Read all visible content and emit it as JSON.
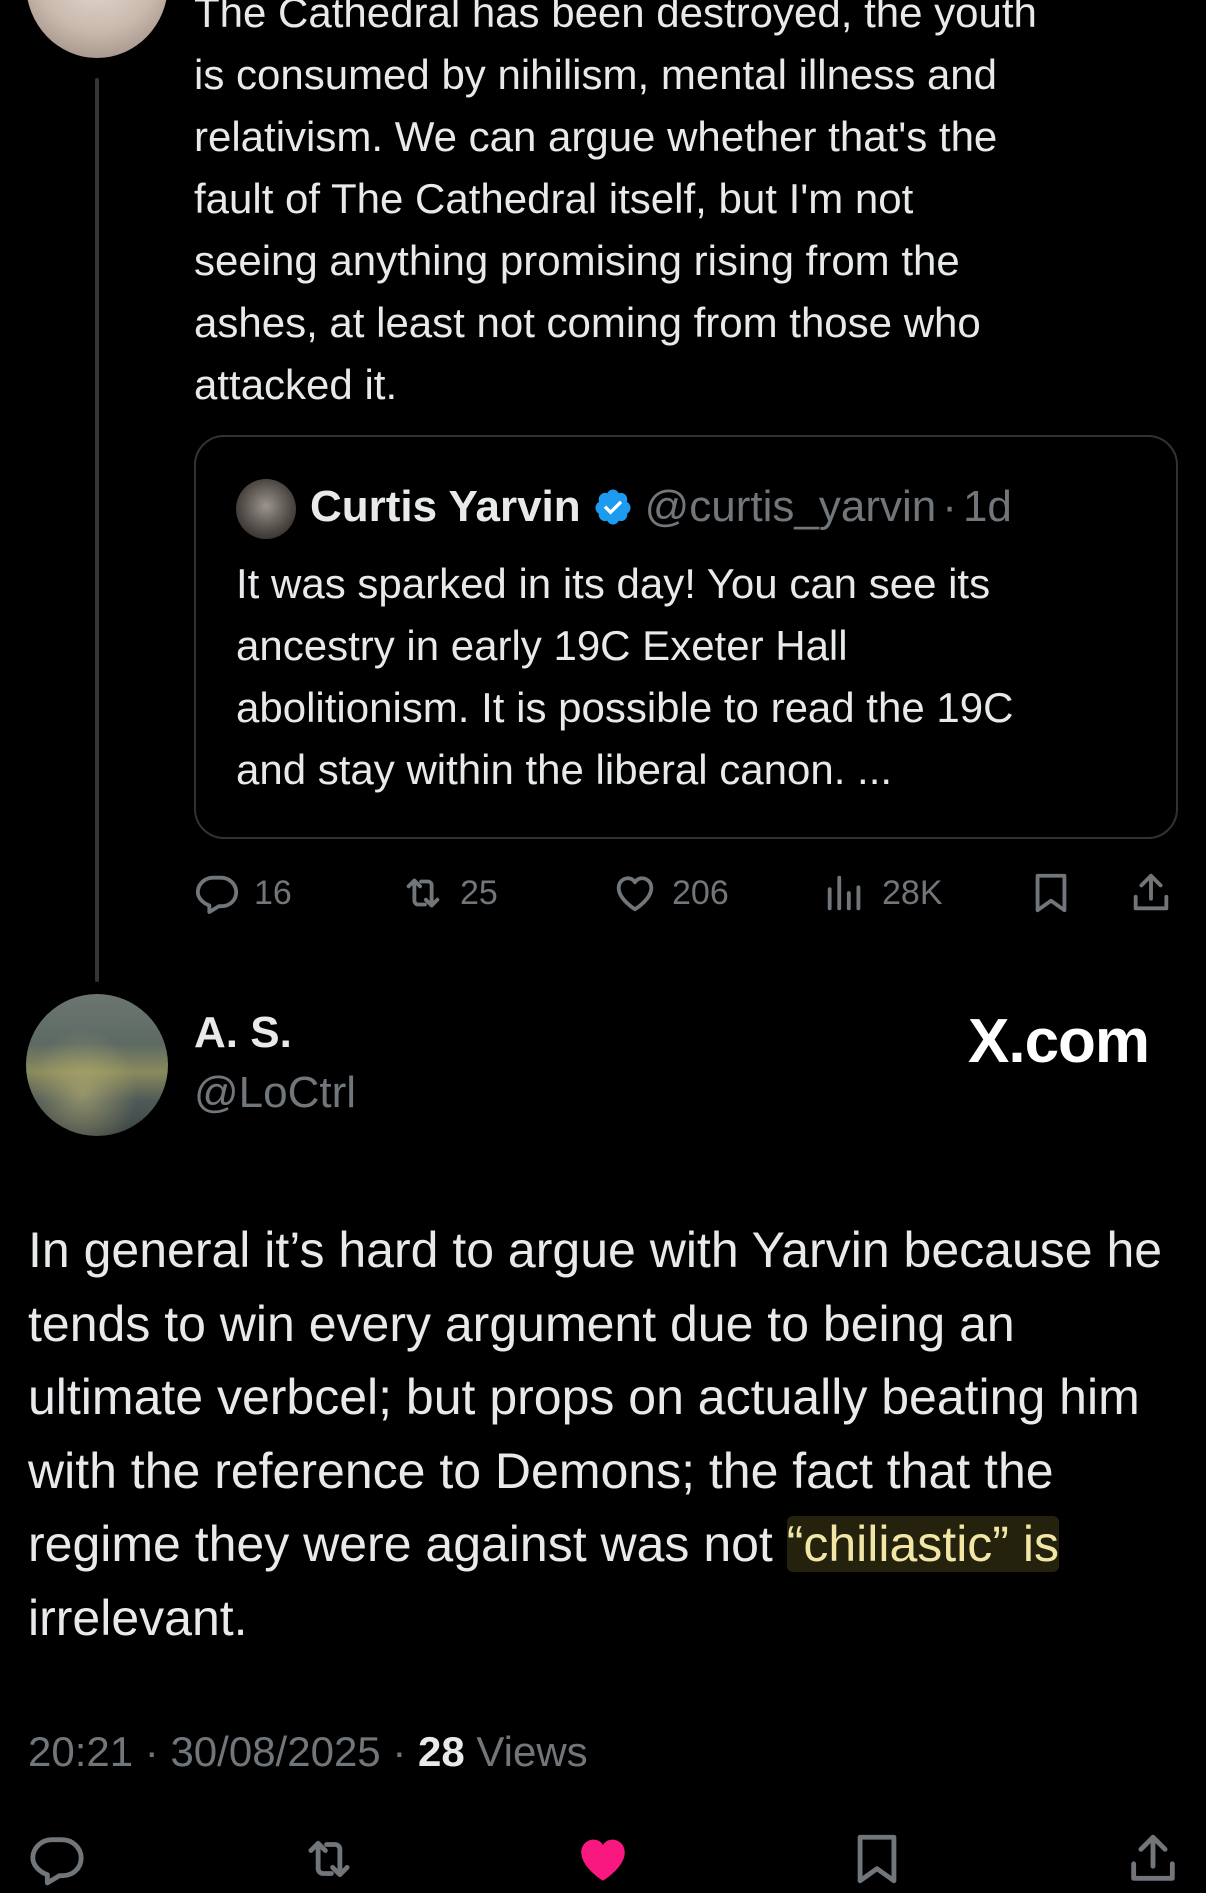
{
  "previous_tweet": {
    "text": "The Cathedral has been destroyed, the youth\nis consumed by nihilism, mental illness and\nrelativism. We can argue whether that's the\nfault of The Cathedral itself, but I'm not\nseeing anything promising rising from the\nashes, at least not coming from those who\nattacked it.",
    "quote": {
      "name": "Curtis Yarvin",
      "handle": "@curtis_yarvin",
      "separator": "·",
      "time": "1d",
      "text": "It was sparked in its day! You can see its\nancestry in early 19C Exeter Hall\nabolitionism. It is possible to read the 19C\nand stay within the liberal canon. ..."
    },
    "actions": {
      "replies": "16",
      "reposts": "25",
      "likes": "206",
      "views": "28K"
    }
  },
  "main_tweet": {
    "author_name": "A. S.",
    "author_handle": "@LoCtrl",
    "watermark": "X.com",
    "text_before": "In general it’s hard to argue with Yarvin because he tends to win every argument due to being an ultimate verbcel; but props on actually beating him with the reference to Demons; the fact that the regime they were against was not ",
    "text_highlight": "“chiliastic” is",
    "text_after": " irrelevant.",
    "time": "20:21",
    "date": "30/08/2025",
    "separator": "·",
    "views_count": "28",
    "views_label": "Views"
  },
  "icons": {
    "reply": "reply-icon",
    "repost": "repost-icon",
    "like": "heart-icon",
    "liked": "heart-filled-icon",
    "views": "views-chart-icon",
    "bookmark": "bookmark-icon",
    "share": "share-icon",
    "verified": "verified-badge-icon"
  },
  "colors": {
    "background": "#000000",
    "text": "#e7e9ea",
    "muted": "#71767b",
    "verified": "#1d9bf0",
    "like_active": "#f91880",
    "highlight_text": "#f1e6a6"
  }
}
